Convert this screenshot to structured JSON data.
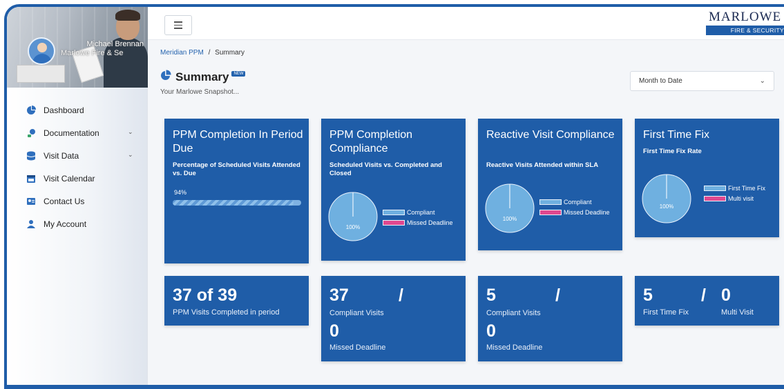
{
  "profile": {
    "name": "Michael Brennan",
    "company": "Marlowe Fire & Se"
  },
  "sidebar": {
    "items": [
      {
        "label": "Dashboard",
        "icon": "pie-chart-icon"
      },
      {
        "label": "Documentation",
        "icon": "bulb-icon",
        "has_chevron": true
      },
      {
        "label": "Visit Data",
        "icon": "database-icon",
        "has_chevron": true
      },
      {
        "label": "Visit Calendar",
        "icon": "calendar-icon"
      },
      {
        "label": "Contact Us",
        "icon": "contact-icon"
      },
      {
        "label": "My Account",
        "icon": "user-icon"
      }
    ]
  },
  "topbar": {
    "logo_word": "MARLOWE",
    "logo_tagline": "FIRE & SECURITY"
  },
  "breadcrumb": {
    "parent": "Meridian PPM",
    "separator": "/",
    "current": "Summary"
  },
  "header": {
    "title": "Summary",
    "badge": "NEW",
    "subtitle": "Your Marlowe Snapshot..."
  },
  "period_select": {
    "value": "Month to Date"
  },
  "colors": {
    "card_blue": "#1f5da8",
    "pie_fill": "#6fb0e0",
    "compliant": "#6fb0e0",
    "missed": "#e0488f"
  },
  "cards": {
    "ppm_due": {
      "title": "PPM Completion In Period Due",
      "desc": "Percentage of Scheduled Visits Attended vs. Due",
      "progress_label": "94%",
      "progress_value": 94
    },
    "ppm_compliance": {
      "title": "PPM Completion Compliance",
      "desc": "Scheduled Visits vs. Completed and Closed",
      "pie_label": "100%",
      "legend": [
        "Compliant",
        "Missed Deadline"
      ]
    },
    "reactive": {
      "title": "Reactive Visit Compliance",
      "desc": "Reactive Visits Attended within SLA",
      "pie_label": "100%",
      "legend": [
        "Compliant",
        "Missed Deadline"
      ]
    },
    "ftf": {
      "title": "First Time Fix",
      "desc": "First Time Fix Rate",
      "pie_label": "100%",
      "legend": [
        "First Time Fix",
        "Multi visit"
      ]
    }
  },
  "stats": {
    "ppm_visits": {
      "value": "37 of 39",
      "label": "PPM Visits Completed in period"
    },
    "ppm_compliance": {
      "value": "37",
      "slash": "/",
      "label": "Compliant Visits",
      "value2": "0",
      "label2": "Missed Deadline"
    },
    "reactive": {
      "value": "5",
      "slash": "/",
      "label": "Compliant Visits",
      "value2": "0",
      "label2": "Missed Deadline"
    },
    "ftf": {
      "value": "5",
      "slash": "/",
      "value2": "0",
      "label": "First Time Fix",
      "label2": "Multi Visit"
    }
  }
}
